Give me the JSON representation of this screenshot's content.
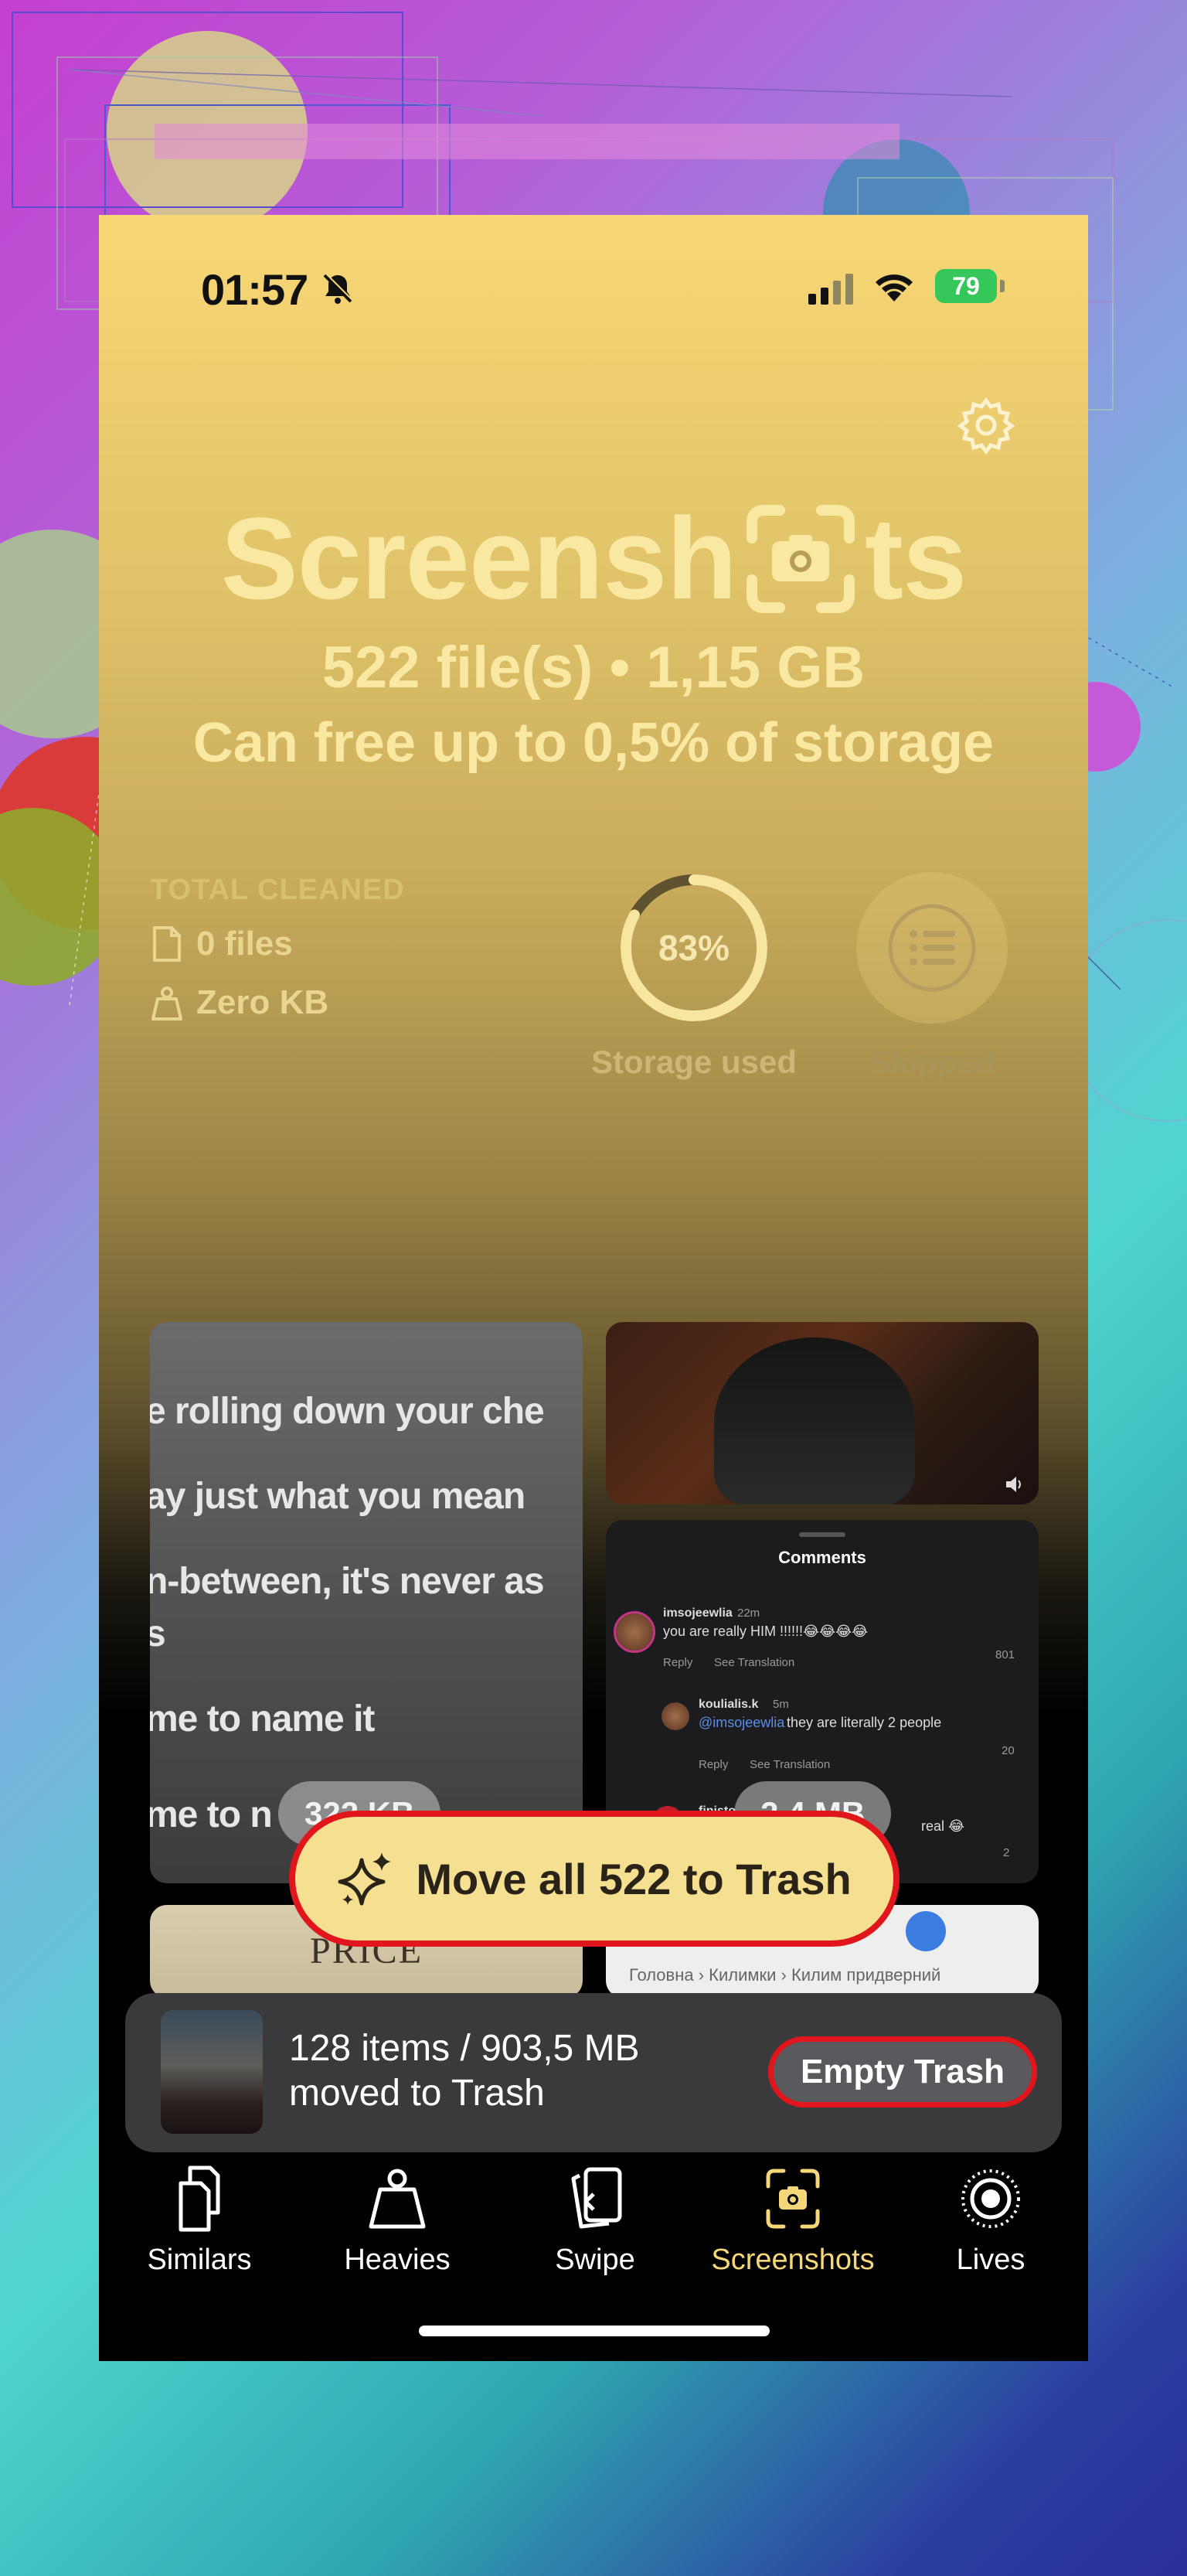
{
  "status_bar": {
    "time": "01:57",
    "battery": "79"
  },
  "header": {
    "title_prefix": "Screensh",
    "title_suffix": "ts",
    "files_summary": "522 file(s) • 1,15 GB",
    "free_up_text": "Can free up to 0,5% of storage"
  },
  "stats": {
    "total_cleaned_label": "TOTAL CLEANED",
    "files_cleaned": "0 files",
    "size_cleaned": "Zero KB",
    "storage_used_percent": 83,
    "storage_used_text": "83%",
    "storage_used_label": "Storage used",
    "skipped_label": "Skipped"
  },
  "thumbnails": {
    "lyrics_lines": [
      "e rolling down your che",
      "ay just what you mean",
      "n-between, it's never as",
      "s",
      "me to name it",
      "me to n"
    ],
    "lyrics_size": "322 KB",
    "comments": {
      "title": "Comments",
      "user1": "imsojeewlia",
      "user1_time": "22m",
      "user1_text": "you are really HIM !!!!!!😂😂😂😂",
      "reply": "Reply",
      "see_translation": "See Translation",
      "user1_likes": "801",
      "user2": "koulialis.k",
      "user2_time": "5m",
      "user2_mention": "@imsojeewlia",
      "user2_text": "they are literally 2 people",
      "user2_likes": "20",
      "user3": "finisto",
      "user3_text": "real 😂",
      "user3_likes": "2",
      "size": "2,4 MB"
    },
    "price_text": "PRICE",
    "shop_breadcrumb": "Головна  ›  Килимки  ›  Килим придверний"
  },
  "actions": {
    "move_all_label": "Move all 522 to Trash"
  },
  "trash": {
    "line1": "128 items / 903,5 MB",
    "line2": "moved to Trash",
    "empty_label": "Empty Trash"
  },
  "tabs": [
    {
      "label": "Similars",
      "icon": "similars-icon"
    },
    {
      "label": "Heavies",
      "icon": "weight-icon"
    },
    {
      "label": "Swipe",
      "icon": "swipe-icon"
    },
    {
      "label": "Screenshots",
      "icon": "screenshot-icon",
      "active": true
    },
    {
      "label": "Lives",
      "icon": "live-photo-icon"
    }
  ],
  "colors": {
    "accent": "#f5d77a",
    "highlight_border": "#e0161c",
    "trash_bar": "#3a3a3c"
  }
}
